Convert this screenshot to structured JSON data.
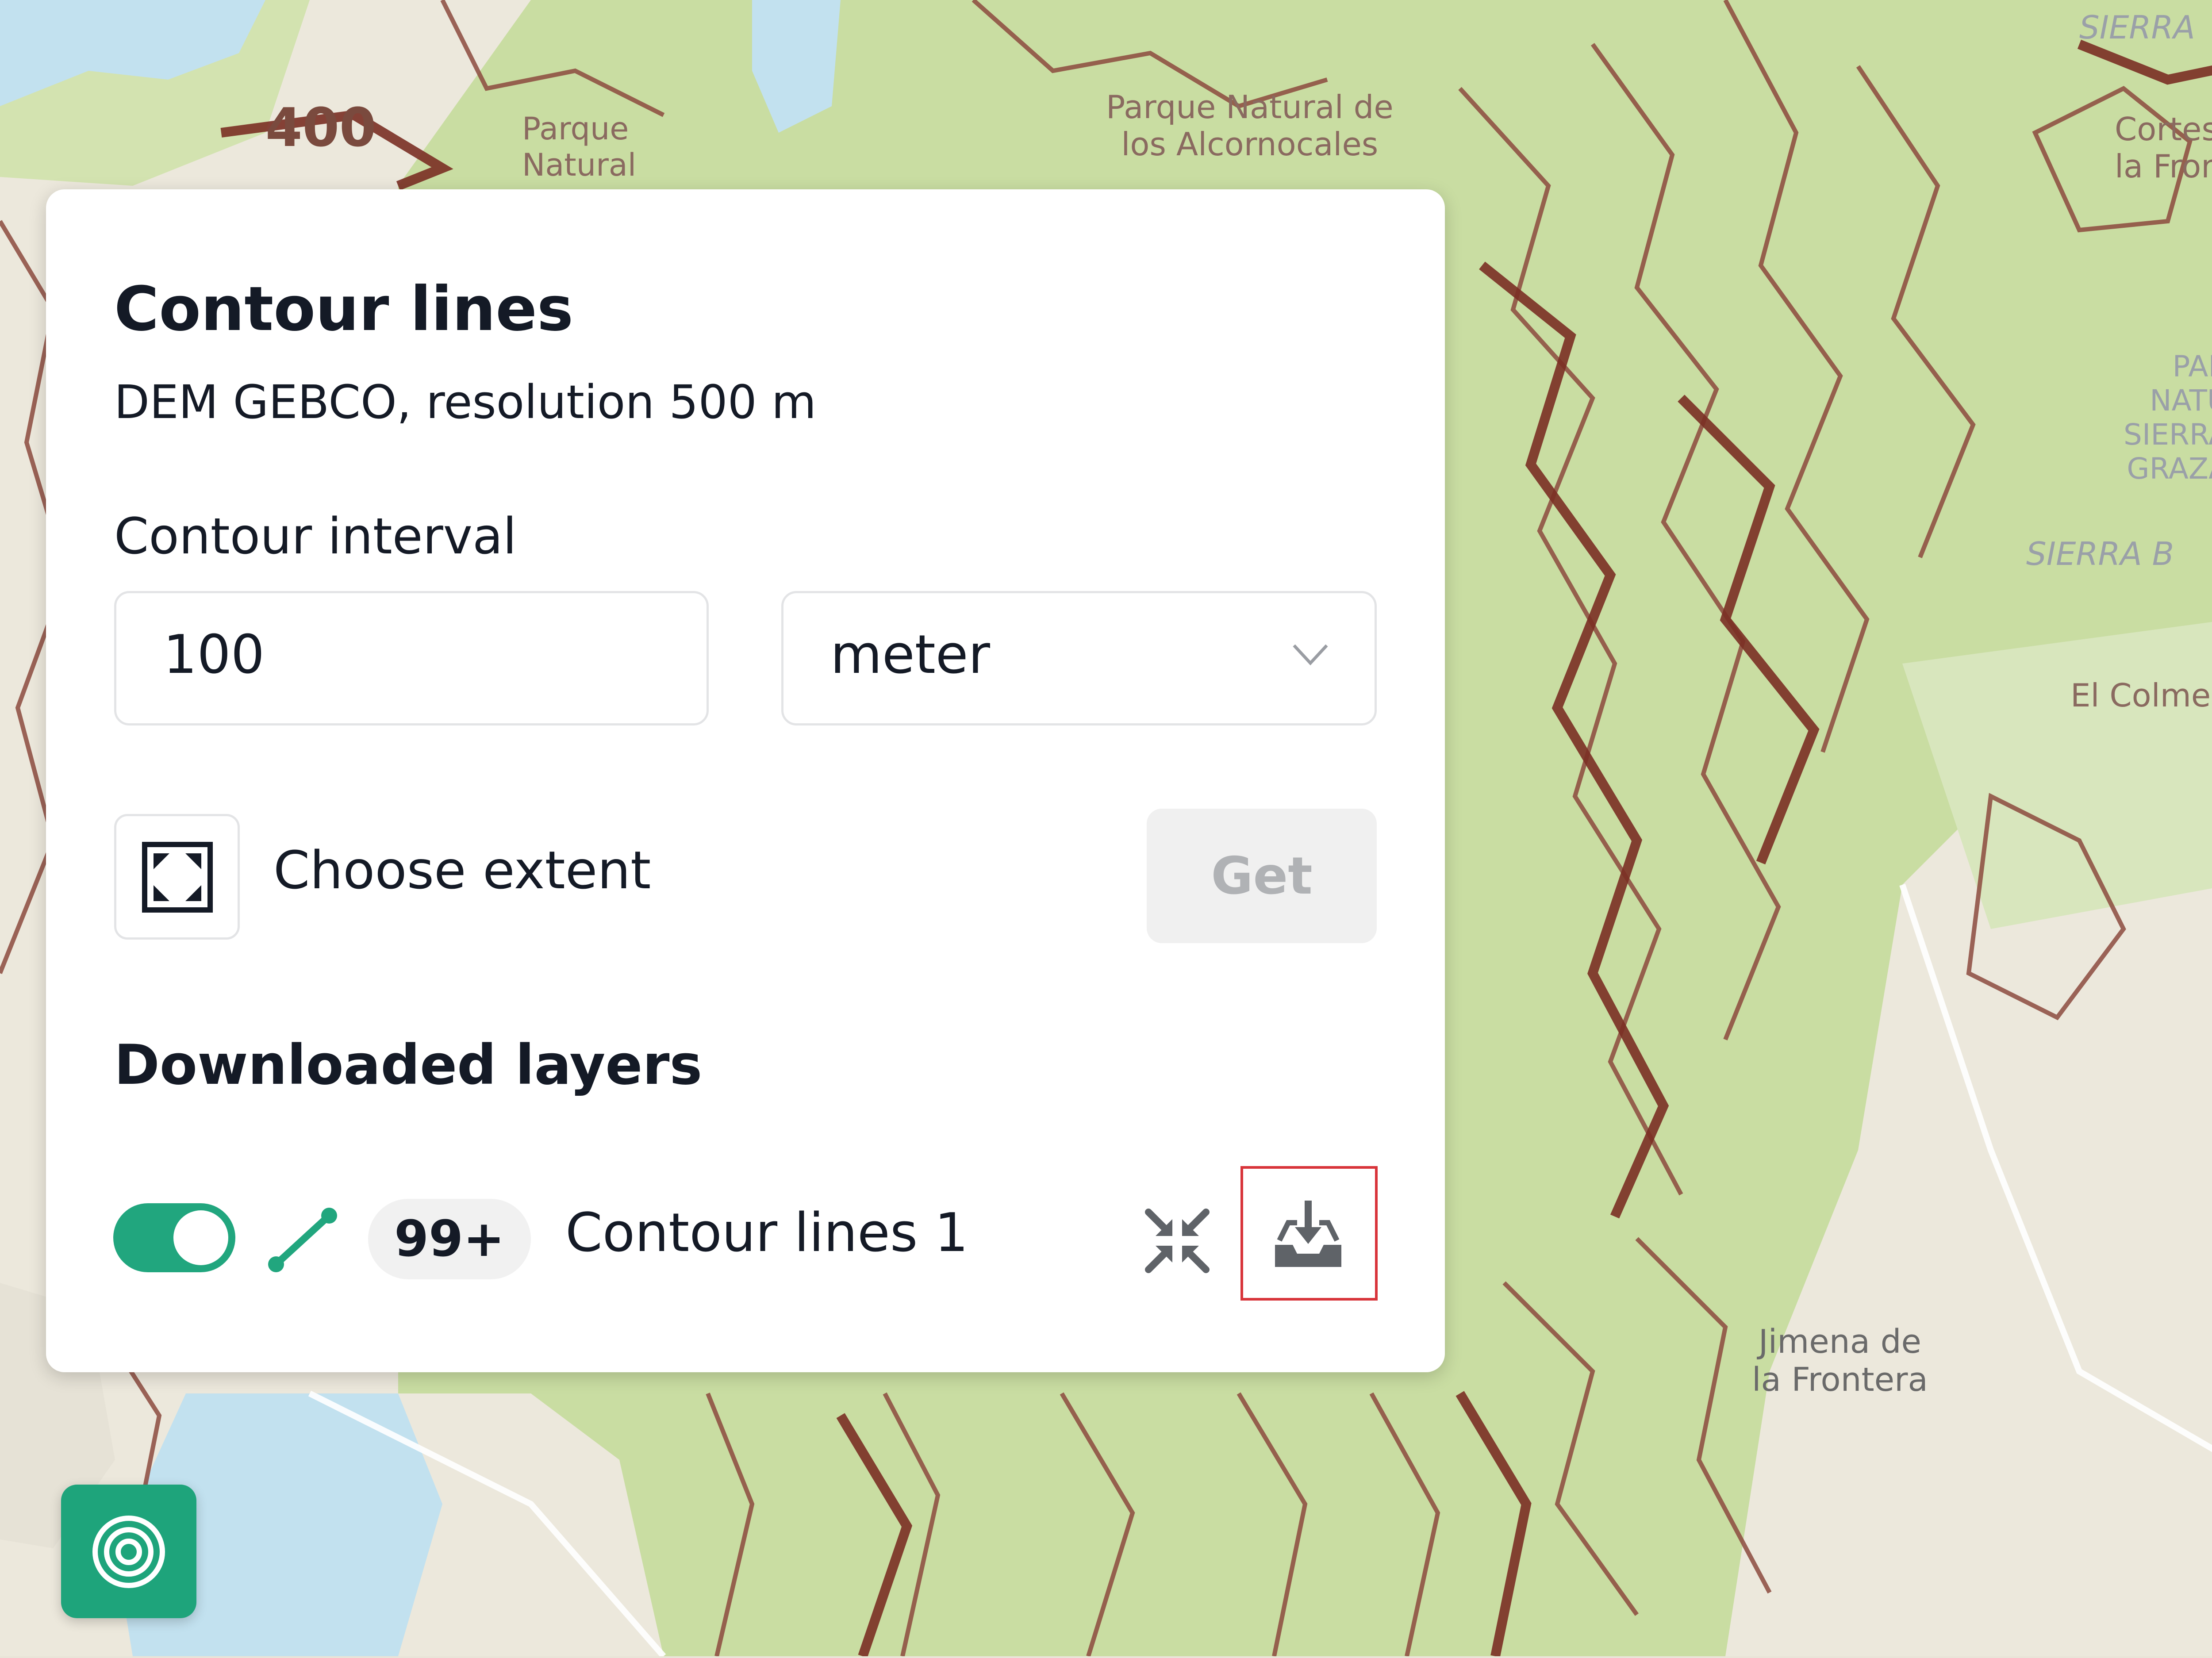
{
  "map": {
    "labels": {
      "elevation": "400",
      "park_west": "Parque\nNatural",
      "park_center": "Parque Natural de\nlos Alcornocales",
      "sierra_top": "SIERRA",
      "cortes": "Cortes\nla Fron",
      "park_east": "PAR\nNATU\nSIERRA\nGRAZA",
      "sierra_east": "SIERRA B",
      "colmenar": "El Colme",
      "jimena": "Jimena de\nla Frontera"
    }
  },
  "panel": {
    "title": "Contour lines",
    "subtitle": "DEM GEBCO, resolution 500 m",
    "interval_label": "Contour interval",
    "interval_value": "100",
    "unit_value": "meter",
    "choose_extent_label": "Choose extent",
    "get_label": "Get",
    "downloaded_heading": "Downloaded layers",
    "layer": {
      "enabled": true,
      "count_badge": "99+",
      "name": "Contour lines 1"
    }
  },
  "icons": {
    "extent": "frame-corners-icon",
    "chevron": "chevron-down-icon",
    "line": "line-segment-icon",
    "collapse": "collapse-arrows-icon",
    "download": "download-tray-icon",
    "fab": "concentric-rings-icon"
  },
  "colors": {
    "accent": "#21a67e",
    "forest": "#c6dca0",
    "contour": "#7a2f24",
    "water": "#bfe0f0",
    "highlight_border": "#d8343a"
  }
}
